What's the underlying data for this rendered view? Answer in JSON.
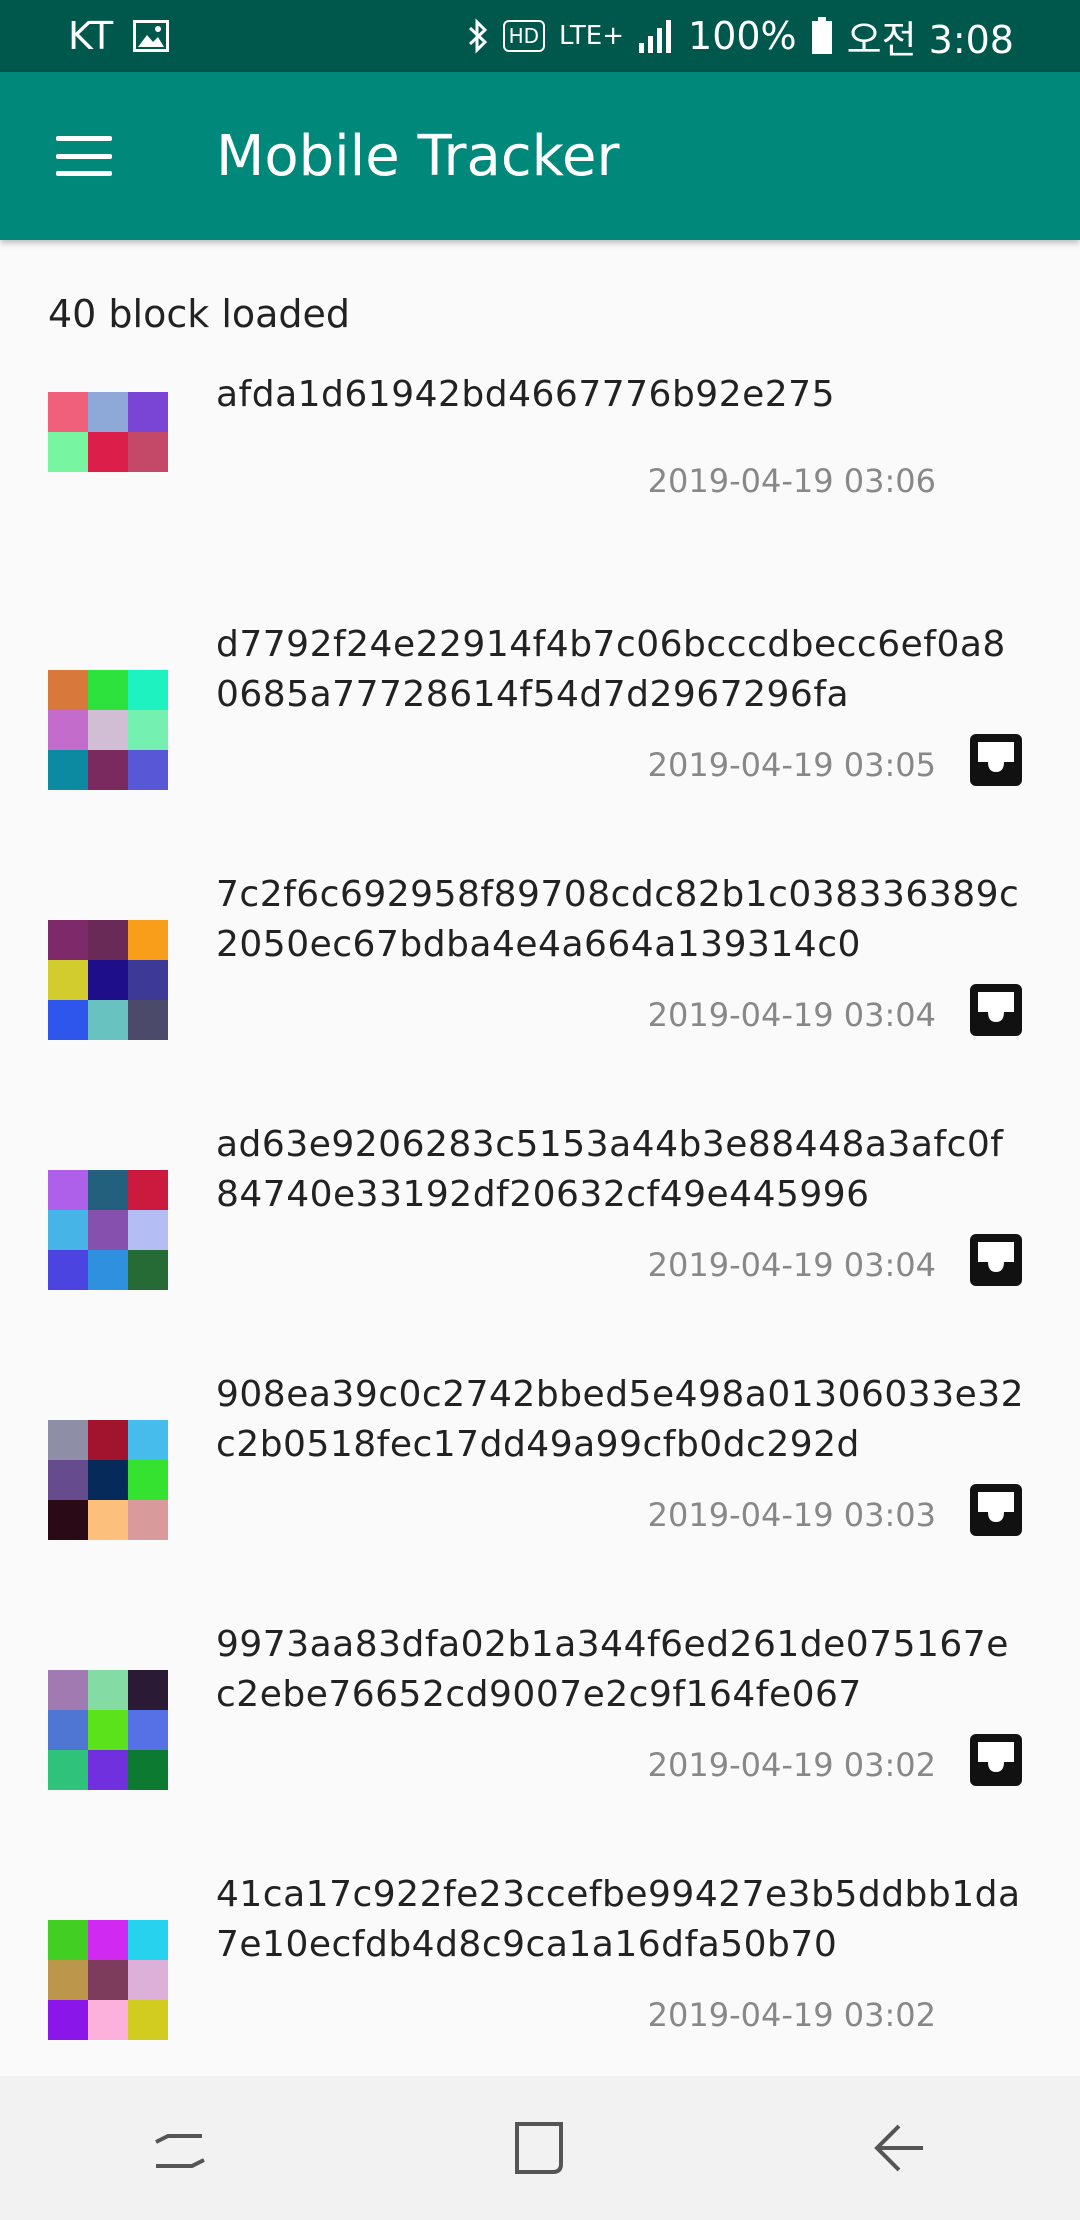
{
  "status_bar": {
    "carrier": "KT",
    "right_text": "LTE+",
    "hd": "HD",
    "battery": "100%",
    "time": "오전 3:08"
  },
  "app_bar": {
    "title": "Mobile Tracker"
  },
  "blocks_loaded": "40 block loaded",
  "blocks": [
    {
      "hash": "afda1d61942bd4667776b92e275",
      "time": "2019-04-19 03:06",
      "has_inbox": false,
      "colors": [
        "#f0607a",
        "#8ea9d8",
        "#7a44d4",
        "#78f5a0",
        "#dc1e4a",
        "#c44868",
        "#fafafa",
        "#fafafa",
        "#fafafa"
      ]
    },
    {
      "hash": "d7792f24e22914f4b7c06bcccdbecc6ef0a80685a77728614f54d7d2967296fa",
      "time": "2019-04-19 03:05",
      "has_inbox": true,
      "colors": [
        "#d8783a",
        "#2ee23e",
        "#1ef2c0",
        "#c46ccc",
        "#d2bed4",
        "#74f0b0",
        "#0c8aa2",
        "#7a2a5e",
        "#5858d6"
      ]
    },
    {
      "hash": "7c2f6c692958f89708cdc82b1c038336389c2050ec67bdba4e4a664a139314c0",
      "time": "2019-04-19 03:04",
      "has_inbox": true,
      "colors": [
        "#7e2a6a",
        "#6a2a58",
        "#f89e1a",
        "#d2cc2e",
        "#1e0e8a",
        "#3c3a96",
        "#2e56ec",
        "#68c2c0",
        "#4c4a6a"
      ]
    },
    {
      "hash": "ad63e9206283c5153a44b3e88448a3afc0f84740e33192df20632cf49e445996",
      "time": "2019-04-19 03:04",
      "has_inbox": true,
      "colors": [
        "#ae60ea",
        "#22607e",
        "#cc1a3e",
        "#46b4e6",
        "#8650ae",
        "#b4bef4",
        "#4c44e0",
        "#3090e0",
        "#266a36"
      ]
    },
    {
      "hash": "908ea39c0c2742bbed5e498a01306033e32c2b0518fec17dd49a99cfb0dc292d",
      "time": "2019-04-19 03:03",
      "has_inbox": true,
      "colors": [
        "#8e8ea6",
        "#a2142e",
        "#46bcec",
        "#664c8e",
        "#062a5a",
        "#36e230",
        "#2a0a16",
        "#fcc07c",
        "#d89a9a"
      ]
    },
    {
      "hash": "9973aa83dfa02b1a344f6ed261de075167ec2ebe76652cd9007e2c9f164fe067",
      "time": "2019-04-19 03:02",
      "has_inbox": true,
      "colors": [
        "#a07ab0",
        "#84dca4",
        "#2a1a36",
        "#4e76d2",
        "#5ce21a",
        "#5670e6",
        "#2ec27a",
        "#7030de",
        "#0c7a30"
      ]
    },
    {
      "hash": "41ca17c922fe23ccefbe99427e3b5ddbb1da7e10ecfdb4d8c9ca1a16dfa50b70",
      "time": "2019-04-19 03:02",
      "has_inbox": false,
      "colors": [
        "#42ce22",
        "#d02af2",
        "#26d2ee",
        "#bc964a",
        "#7e3c5c",
        "#dcb0d8",
        "#8a16ea",
        "#fcb0dc",
        "#d2cc20"
      ]
    }
  ],
  "colors": {
    "status_bar": "#00574b",
    "app_bar": "#00897b"
  },
  "icons": {
    "menu": "hamburger-menu-icon",
    "inbox": "inbox-icon",
    "recents": "recent-apps-icon",
    "home": "home-icon",
    "back": "back-icon"
  }
}
